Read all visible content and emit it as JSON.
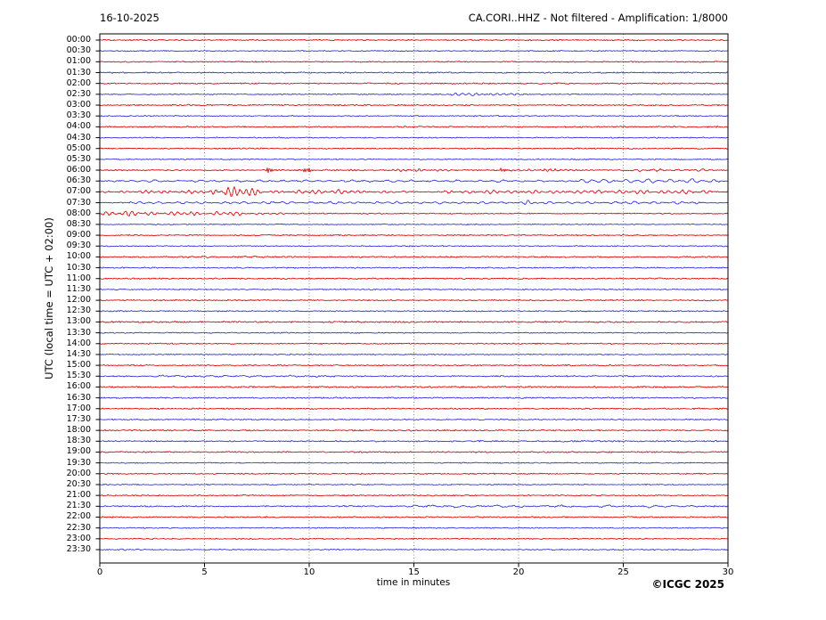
{
  "header": {
    "date": "16-10-2025",
    "title": "CA.CORI..HHZ - Not filtered - Amplification: 1/8000"
  },
  "footer": {
    "credit": "©ICGC 2025"
  },
  "axes": {
    "y_label": "UTC (local time = UTC + 02:00)",
    "x_label": "time in minutes",
    "x_ticks": [
      0,
      5,
      10,
      15,
      20,
      25,
      30
    ],
    "x_range": [
      0,
      30
    ]
  },
  "colors": {
    "trace_red": "#dd0000",
    "trace_blue": "#2c2cdb",
    "grid": "#555555",
    "frame": "#000000",
    "background": "#ffffff"
  },
  "chart_data": {
    "type": "line",
    "subtype": "helicorder-dayplot",
    "title": "CA.CORI..HHZ - Not filtered - Amplification: 1/8000",
    "date": "16-10-2025",
    "xlabel": "time in minutes",
    "ylabel": "UTC (local time = UTC + 02:00)",
    "x_range": [
      0,
      30
    ],
    "x_ticks": [
      0,
      5,
      10,
      15,
      20,
      25,
      30
    ],
    "grid": "vertical-dotted",
    "minutes_per_row": 30,
    "rows": [
      {
        "label": "00:00",
        "color": "red",
        "noise": 0.55,
        "events": []
      },
      {
        "label": "00:30",
        "color": "blue",
        "noise": 0.5,
        "events": []
      },
      {
        "label": "01:00",
        "color": "red",
        "noise": 0.55,
        "events": []
      },
      {
        "label": "01:30",
        "color": "blue",
        "noise": 0.6,
        "events": []
      },
      {
        "label": "02:00",
        "color": "red",
        "noise": 0.6,
        "events": []
      },
      {
        "label": "02:30",
        "color": "blue",
        "noise": 0.5,
        "events": [
          {
            "start": 16.5,
            "end": 23,
            "amp": 1.5,
            "freq": 3,
            "shape": "burst"
          }
        ]
      },
      {
        "label": "03:00",
        "color": "red",
        "noise": 0.6,
        "events": [
          {
            "start": 3.5,
            "end": 6,
            "amp": 0.7,
            "freq": 3,
            "shape": "burst"
          }
        ]
      },
      {
        "label": "03:30",
        "color": "blue",
        "noise": 0.5,
        "events": []
      },
      {
        "label": "04:00",
        "color": "red",
        "noise": 0.6,
        "events": []
      },
      {
        "label": "04:30",
        "color": "blue",
        "noise": 0.5,
        "events": []
      },
      {
        "label": "05:00",
        "color": "red",
        "noise": 0.55,
        "events": []
      },
      {
        "label": "05:30",
        "color": "blue",
        "noise": 0.5,
        "events": []
      },
      {
        "label": "06:00",
        "color": "red",
        "noise": 0.55,
        "events": [
          {
            "start": 7.9,
            "end": 8.7,
            "amp": 2.2,
            "freq": 14,
            "shape": "burst"
          },
          {
            "start": 9.6,
            "end": 10.3,
            "amp": 4.2,
            "freq": 14,
            "shape": "burst"
          },
          {
            "start": 10.3,
            "end": 13.5,
            "amp": 1.1,
            "freq": 6,
            "shape": "burst"
          },
          {
            "start": 13.5,
            "end": 17,
            "amp": 0.7,
            "freq": 4,
            "shape": "const"
          },
          {
            "start": 19.1,
            "end": 19.5,
            "amp": 2.6,
            "freq": 14,
            "shape": "burst"
          },
          {
            "start": 19.5,
            "end": 23.5,
            "amp": 1.0,
            "freq": 4,
            "shape": "const"
          },
          {
            "start": 25,
            "end": 29.5,
            "amp": 0.9,
            "freq": 2.5,
            "shape": "const"
          }
        ]
      },
      {
        "label": "06:30",
        "color": "blue",
        "noise": 0.45,
        "events": [
          {
            "start": 0,
            "end": 22,
            "amp": 0.85,
            "freq": 1.8,
            "shape": "const"
          },
          {
            "start": 22,
            "end": 30,
            "amp": 1.7,
            "freq": 1.9,
            "shape": "const"
          }
        ]
      },
      {
        "label": "07:00",
        "color": "red",
        "noise": 0.55,
        "events": [
          {
            "start": 0,
            "end": 5.2,
            "amp": 1.3,
            "freq": 3.4,
            "shape": "const"
          },
          {
            "start": 5.2,
            "end": 9.3,
            "amp": 7.2,
            "freq": 3.5,
            "shape": "burst"
          },
          {
            "start": 9,
            "end": 16,
            "amp": 2.4,
            "freq": 3.2,
            "shape": "burst"
          },
          {
            "start": 16,
            "end": 30,
            "amp": 1.5,
            "freq": 3,
            "shape": "const"
          }
        ]
      },
      {
        "label": "07:30",
        "color": "blue",
        "noise": 0.45,
        "events": [
          {
            "start": 0,
            "end": 30,
            "amp": 0.9,
            "freq": 2.2,
            "shape": "const"
          },
          {
            "start": 20.2,
            "end": 22.3,
            "amp": 2.0,
            "freq": 2.8,
            "shape": "burst"
          }
        ]
      },
      {
        "label": "08:00",
        "color": "red",
        "noise": 0.5,
        "events": [
          {
            "start": 0,
            "end": 2,
            "amp": 2.2,
            "freq": 3.2,
            "shape": "const"
          },
          {
            "start": 2,
            "end": 7,
            "amp": 1.6,
            "freq": 3.2,
            "shape": "const"
          },
          {
            "start": 7,
            "end": 12,
            "amp": 1.0,
            "freq": 3,
            "shape": "burst"
          },
          {
            "start": 12,
            "end": 15,
            "amp": 0.5,
            "freq": 3,
            "shape": "burst"
          }
        ]
      },
      {
        "label": "08:30",
        "color": "blue",
        "noise": 0.45,
        "events": []
      },
      {
        "label": "09:00",
        "color": "red",
        "noise": 0.55,
        "events": []
      },
      {
        "label": "09:30",
        "color": "blue",
        "noise": 0.5,
        "events": []
      },
      {
        "label": "10:00",
        "color": "red",
        "noise": 0.65,
        "events": [
          {
            "start": 4,
            "end": 8,
            "amp": 0.6,
            "freq": 2,
            "shape": "const"
          }
        ]
      },
      {
        "label": "10:30",
        "color": "blue",
        "noise": 0.55,
        "events": []
      },
      {
        "label": "11:00",
        "color": "red",
        "noise": 0.6,
        "events": []
      },
      {
        "label": "11:30",
        "color": "blue",
        "noise": 0.55,
        "events": []
      },
      {
        "label": "12:00",
        "color": "red",
        "noise": 0.55,
        "events": []
      },
      {
        "label": "12:30",
        "color": "blue",
        "noise": 0.55,
        "events": []
      },
      {
        "label": "13:00",
        "color": "red",
        "noise": 0.7,
        "events": []
      },
      {
        "label": "13:30",
        "color": "blue",
        "noise": 0.5,
        "events": []
      },
      {
        "label": "14:00",
        "color": "red",
        "noise": 0.55,
        "events": []
      },
      {
        "label": "14:30",
        "color": "blue",
        "noise": 0.5,
        "events": []
      },
      {
        "label": "15:00",
        "color": "red",
        "noise": 0.55,
        "events": []
      },
      {
        "label": "15:30",
        "color": "blue",
        "noise": 0.6,
        "events": [
          {
            "start": 2,
            "end": 12,
            "amp": 0.6,
            "freq": 1.3,
            "shape": "const"
          }
        ]
      },
      {
        "label": "16:00",
        "color": "red",
        "noise": 0.7,
        "events": []
      },
      {
        "label": "16:30",
        "color": "blue",
        "noise": 0.6,
        "events": []
      },
      {
        "label": "17:00",
        "color": "red",
        "noise": 0.6,
        "events": []
      },
      {
        "label": "17:30",
        "color": "blue",
        "noise": 0.55,
        "events": []
      },
      {
        "label": "18:00",
        "color": "red",
        "noise": 0.6,
        "events": []
      },
      {
        "label": "18:30",
        "color": "blue",
        "noise": 0.65,
        "events": []
      },
      {
        "label": "19:00",
        "color": "red",
        "noise": 0.6,
        "events": []
      },
      {
        "label": "19:30",
        "color": "blue",
        "noise": 0.5,
        "events": []
      },
      {
        "label": "20:00",
        "color": "red",
        "noise": 0.55,
        "events": []
      },
      {
        "label": "20:30",
        "color": "blue",
        "noise": 0.5,
        "events": []
      },
      {
        "label": "21:00",
        "color": "red",
        "noise": 0.55,
        "events": []
      },
      {
        "label": "21:30",
        "color": "blue",
        "noise": 0.6,
        "events": [
          {
            "start": 14,
            "end": 29,
            "amp": 0.8,
            "freq": 1.3,
            "shape": "const"
          }
        ]
      },
      {
        "label": "22:00",
        "color": "red",
        "noise": 0.6,
        "events": []
      },
      {
        "label": "22:30",
        "color": "blue",
        "noise": 0.5,
        "events": []
      },
      {
        "label": "23:00",
        "color": "red",
        "noise": 0.55,
        "events": []
      },
      {
        "label": "23:30",
        "color": "blue",
        "noise": 0.5,
        "events": [
          {
            "start": 0.8,
            "end": 3,
            "amp": 0.7,
            "freq": 2.5,
            "shape": "burst"
          }
        ]
      }
    ]
  }
}
